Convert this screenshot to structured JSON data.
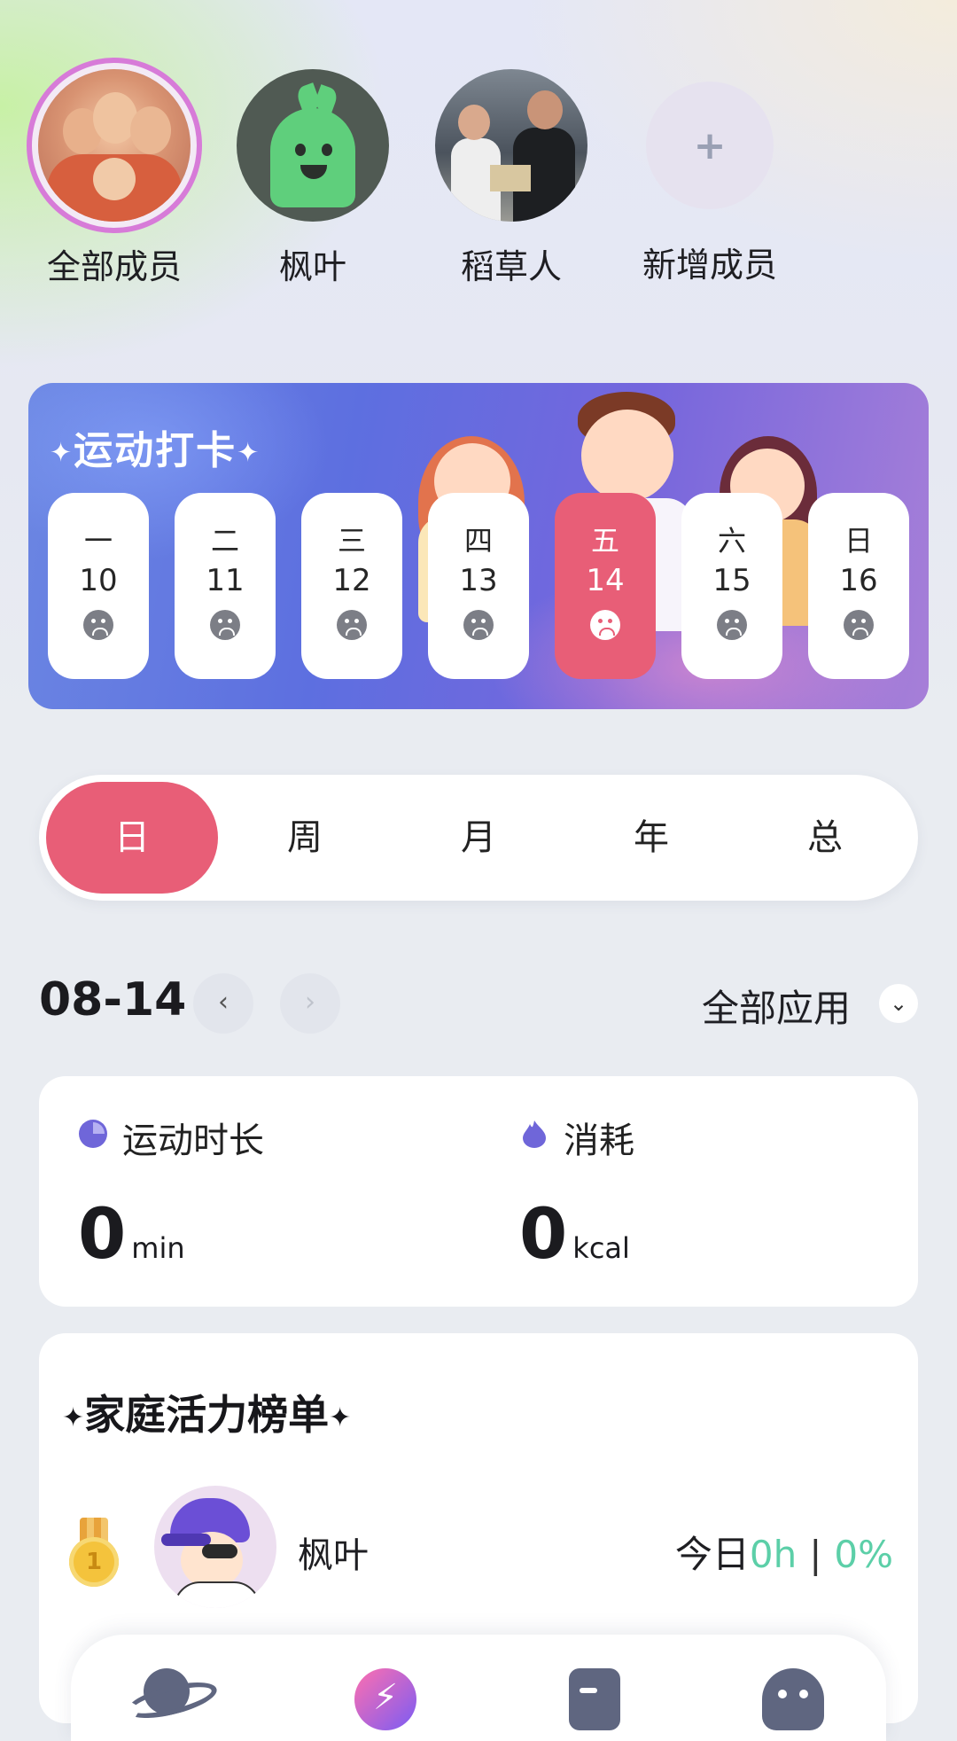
{
  "members": [
    {
      "name": "全部成员",
      "icon": "family-photo-avatar",
      "selected": true
    },
    {
      "name": "枫叶",
      "icon": "sprout-avatar",
      "selected": false
    },
    {
      "name": "稻草人",
      "icon": "couple-photo-avatar",
      "selected": false
    }
  ],
  "add_member": {
    "icon_glyph": "+",
    "label": "新增成员"
  },
  "checkin": {
    "title": "运动打卡",
    "sparkle": "✦",
    "days": [
      {
        "weekday": "一",
        "date": "10",
        "status": "sad-face-icon"
      },
      {
        "weekday": "二",
        "date": "11",
        "status": "sad-face-icon"
      },
      {
        "weekday": "三",
        "date": "12",
        "status": "sad-face-icon"
      },
      {
        "weekday": "四",
        "date": "13",
        "status": "sad-face-icon"
      },
      {
        "weekday": "五",
        "date": "14",
        "status": "sad-face-icon",
        "active": true
      },
      {
        "weekday": "六",
        "date": "15",
        "status": "sad-face-icon"
      },
      {
        "weekday": "日",
        "date": "16",
        "status": "sad-face-icon"
      }
    ]
  },
  "period_tabs": [
    {
      "label": "日",
      "active": true
    },
    {
      "label": "周"
    },
    {
      "label": "月"
    },
    {
      "label": "年"
    },
    {
      "label": "总"
    }
  ],
  "date_row": {
    "date": "08-14",
    "prev_glyph": "‹",
    "next_glyph": "›",
    "filter_label": "全部应用",
    "filter_glyph": "⌄"
  },
  "stats": {
    "duration": {
      "label": "运动时长",
      "value": "0",
      "unit": "min",
      "icon": "clock-icon"
    },
    "calories": {
      "label": "消耗",
      "value": "0",
      "unit": "kcal",
      "icon": "flame-icon"
    }
  },
  "ranking": {
    "title": "家庭活力榜单",
    "sparkle": "✦",
    "entries": [
      {
        "rank": "1",
        "name": "枫叶",
        "today_label": "今日",
        "hours": "0h",
        "separator": "|",
        "percent": "0%"
      }
    ]
  },
  "bottom_nav": [
    "planet-icon",
    "lightning-icon",
    "document-icon",
    "robot-icon"
  ],
  "colors": {
    "accent": "#e85e77",
    "green": "#5ccfa8",
    "purple": "#6f66d9"
  }
}
